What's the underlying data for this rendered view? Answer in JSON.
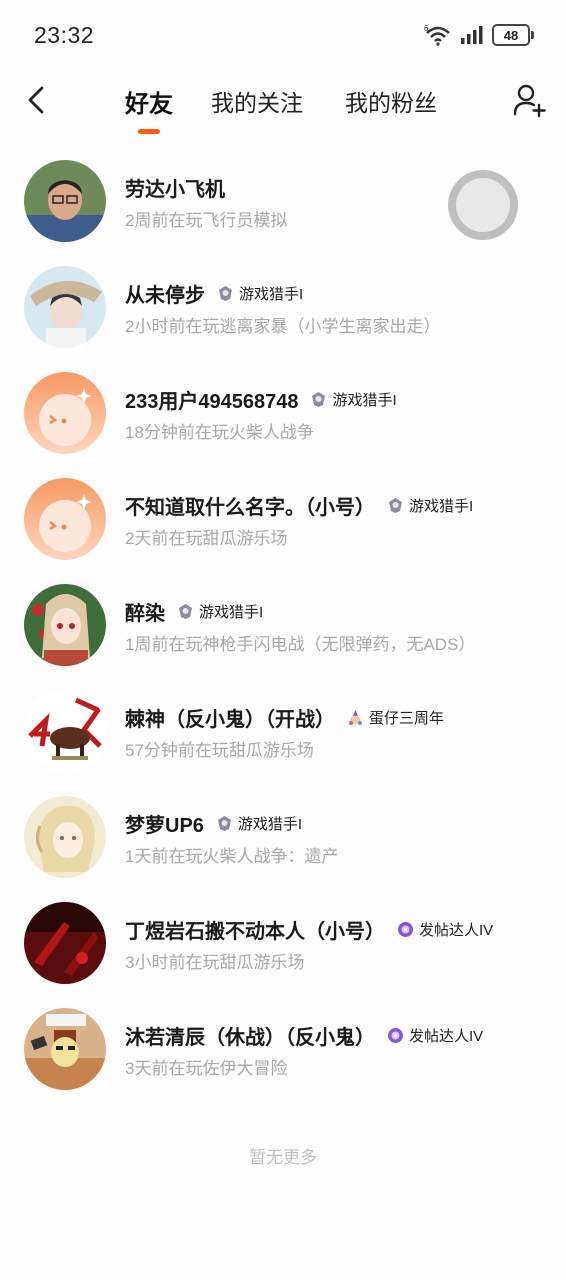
{
  "status_bar": {
    "time": "23:32",
    "battery": "48",
    "wifi_label": "6"
  },
  "tabs": [
    {
      "label": "好友",
      "active": true
    },
    {
      "label": "我的关注",
      "active": false
    },
    {
      "label": "我的粉丝",
      "active": false
    }
  ],
  "accent_color": "#ff5b14",
  "friends": [
    {
      "name": "劳达小飞机",
      "badge": "",
      "badge_icon": "",
      "status": "2周前在玩飞行员模拟"
    },
    {
      "name": "从未停步",
      "badge": "游戏猎手I",
      "badge_icon": "hunter-badge-icon",
      "status": "2小时前在玩逃离家暴（小学生离家出走）"
    },
    {
      "name": "233用户494568748",
      "badge": "游戏猎手I",
      "badge_icon": "hunter-badge-icon",
      "status": "18分钟前在玩火柴人战争"
    },
    {
      "name": "不知道取什么名字。（小号）",
      "badge": "游戏猎手I",
      "badge_icon": "hunter-badge-icon",
      "status": "2天前在玩甜瓜游乐场"
    },
    {
      "name": "醉染",
      "badge": "游戏猎手I",
      "badge_icon": "hunter-badge-icon",
      "status": "1周前在玩神枪手闪电战（无限弹药，无ADS）"
    },
    {
      "name": "棘神（反小鬼）（开战）",
      "badge": "蛋仔三周年",
      "badge_icon": "anniversary-badge-icon",
      "status": "57分钟前在玩甜瓜游乐场"
    },
    {
      "name": "梦萝UP6",
      "badge": "游戏猎手I",
      "badge_icon": "hunter-badge-icon",
      "status": "1天前在玩火柴人战争：遗产"
    },
    {
      "name": "丁煜岩石搬不动本人（小号）",
      "badge": "发帖达人IV",
      "badge_icon": "poster-badge-icon",
      "status": "3小时前在玩甜瓜游乐场"
    },
    {
      "name": "沐若清辰（休战）（反小鬼）",
      "badge": "发帖达人IV",
      "badge_icon": "poster-badge-icon",
      "status": "3天前在玩佐伊大冒险"
    }
  ],
  "footer": {
    "no_more": "暂无更多"
  }
}
